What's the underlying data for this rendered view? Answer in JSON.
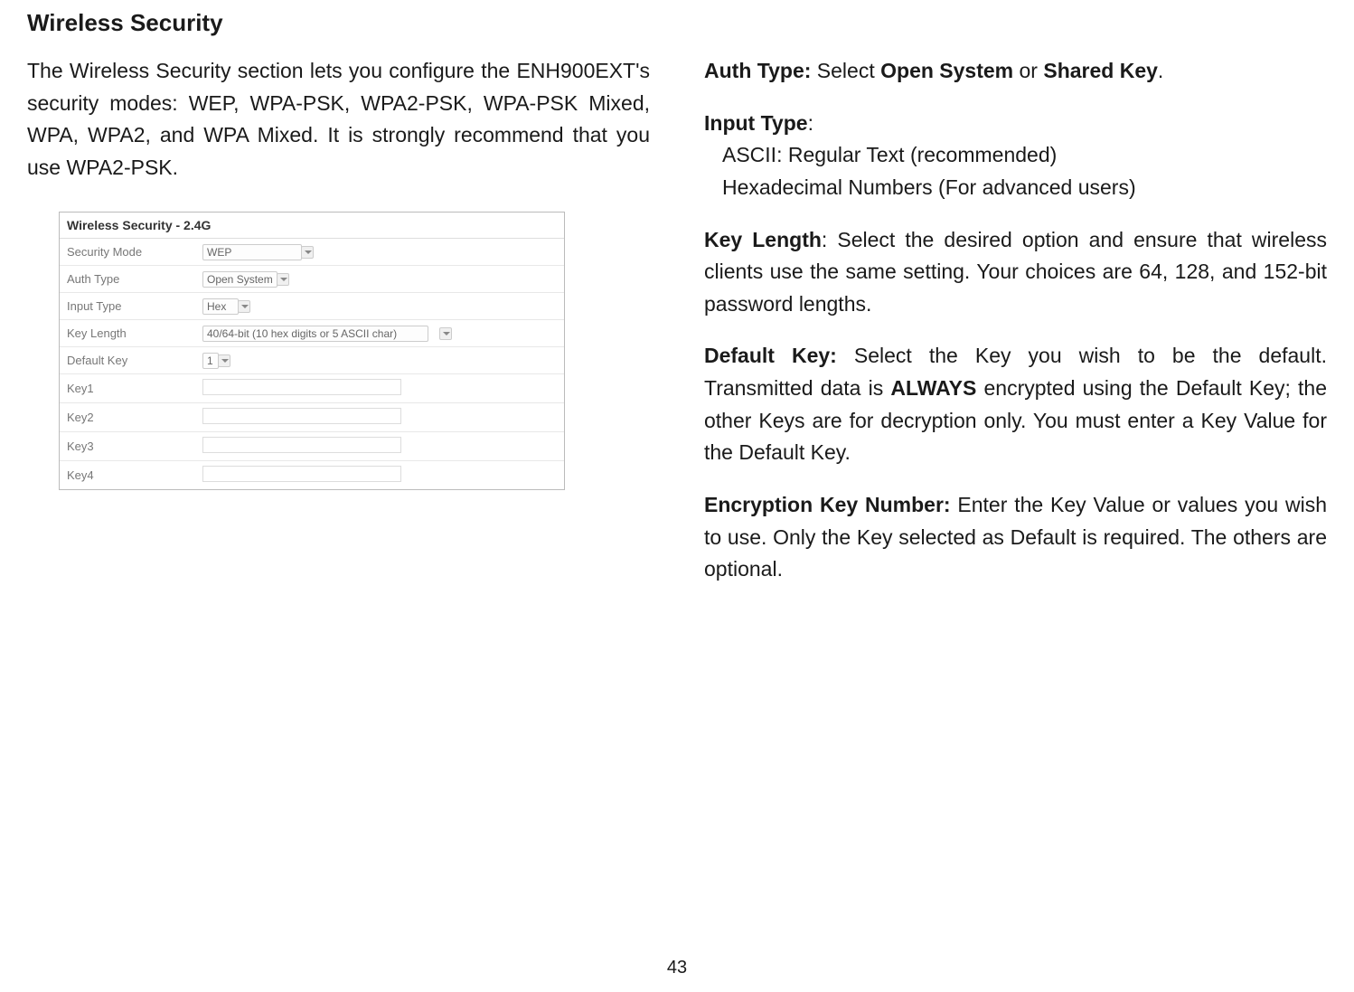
{
  "title": "Wireless Security",
  "intro": "The Wireless Security section lets you configure the ENH900EXT's security modes: WEP, WPA-PSK, WPA2-PSK, WPA-PSK Mixed, WPA, WPA2, and WPA Mixed. It is strongly recommend that you use WPA2-PSK.",
  "screenshot": {
    "panel_title": "Wireless Security - 2.4G",
    "rows": {
      "security_mode": {
        "label": "Security Mode",
        "value": "WEP"
      },
      "auth_type": {
        "label": "Auth Type",
        "value": "Open System"
      },
      "input_type": {
        "label": "Input Type",
        "value": "Hex"
      },
      "key_length": {
        "label": "Key Length",
        "value": "40/64-bit (10 hex digits or 5 ASCII char)"
      },
      "default_key": {
        "label": "Default Key",
        "value": "1"
      },
      "key1": {
        "label": "Key1"
      },
      "key2": {
        "label": "Key2"
      },
      "key3": {
        "label": "Key3"
      },
      "key4": {
        "label": "Key4"
      }
    }
  },
  "right": {
    "auth_type": {
      "label": "Auth Type:",
      "text1": " Select ",
      "opt1": "Open System",
      "text2": " or ",
      "opt2": "Shared Key",
      "text3": "."
    },
    "input_type": {
      "label": "Input Type",
      "colon": ":",
      "line1": "ASCII: Regular Text (recommended)",
      "line2": "Hexadecimal Numbers (For advanced users)"
    },
    "key_length": {
      "label": "Key Length",
      "text": ": Select the desired option and ensure that wireless clients use the same setting. Your choices are 64, 128, and 152-bit password lengths."
    },
    "default_key": {
      "label": "Default Key:",
      "text1": " Select the Key you wish to be the default. Transmitted data is ",
      "always": "ALWAYS",
      "text2": " encrypted using the Default Key; the other Keys are for decryption only. You must enter a Key Value for the Default Key."
    },
    "encryption_key": {
      "label": "Encryption Key Number:",
      "text": " Enter the Key Value or values you wish to use. Only the Key selected as Default is required. The others are optional."
    }
  },
  "page_number": "43"
}
